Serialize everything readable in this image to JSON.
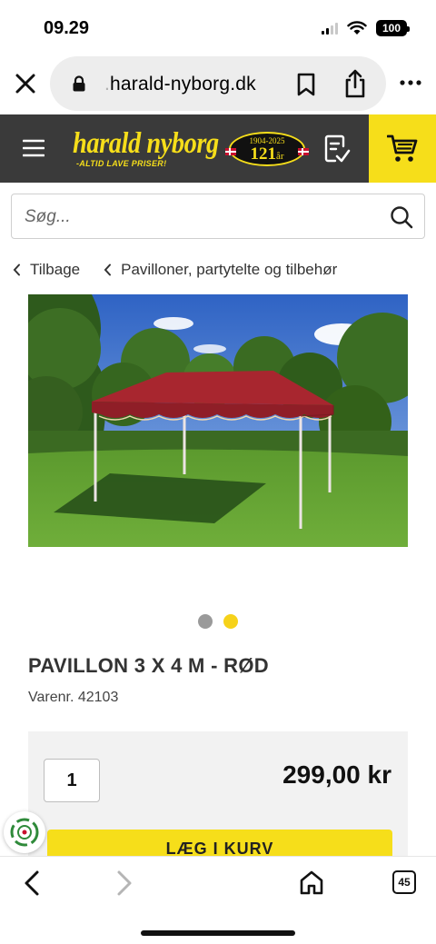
{
  "status_bar": {
    "time": "09.29",
    "battery": "100"
  },
  "browser": {
    "url_prefix": ".",
    "url_domain": "harald-nyborg.dk",
    "tab_count": "45"
  },
  "header": {
    "logo_name": "harald nyborg",
    "logo_tagline": "-ALTID LAVE PRISER!",
    "anniversary_years": "1904-2025",
    "anniversary_count": "121",
    "anniversary_unit": "år",
    "accent_color": "#f6de1a",
    "bar_color": "#3a3a3a"
  },
  "search": {
    "placeholder": "Søg..."
  },
  "breadcrumb": {
    "back_label": "Tilbage",
    "category_label": "Pavilloner, partytelte og tilbehør"
  },
  "carousel": {
    "image_count": 2,
    "active_index": 1
  },
  "product": {
    "title": "PAVILLON 3 X 4 M - RØD",
    "sku": "Varenr. 42103",
    "quantity": "1",
    "price": "299,00 kr",
    "add_to_cart_label": "LÆG I KURV"
  },
  "icons": {
    "close": "close-icon",
    "lock": "lock-icon",
    "bookmark": "bookmark-icon",
    "share": "share-icon",
    "more": "more-icon",
    "menu": "menu-icon",
    "list": "shopping-list-icon",
    "cart": "cart-icon",
    "search": "search-icon",
    "back": "chevron-left-icon",
    "forward": "chevron-right-icon",
    "home": "home-icon",
    "tabs": "tabs-icon"
  }
}
